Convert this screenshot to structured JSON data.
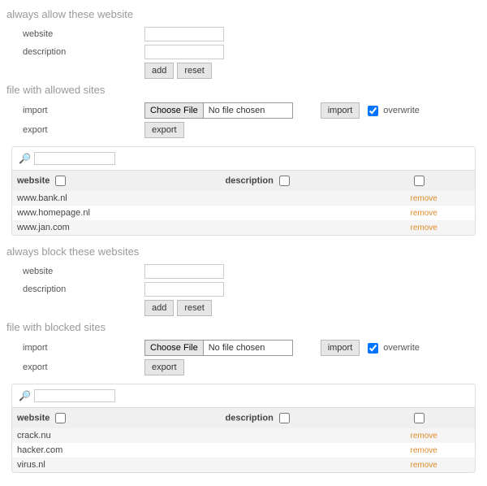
{
  "allow": {
    "title": "always allow these website",
    "website_label": "website",
    "description_label": "description",
    "add": "add",
    "reset": "reset"
  },
  "allow_file": {
    "title": "file with allowed sites",
    "import_label": "import",
    "export_label": "export",
    "choose_file": "Choose File",
    "no_file": "No file chosen",
    "import_btn": "import",
    "overwrite_label": "overwrite",
    "export_btn": "export"
  },
  "allow_table": {
    "header_website": "website",
    "header_description": "description",
    "remove": "remove",
    "rows": [
      {
        "website": "www.bank.nl",
        "description": ""
      },
      {
        "website": "www.homepage.nl",
        "description": ""
      },
      {
        "website": "www.jan.com",
        "description": ""
      }
    ]
  },
  "block": {
    "title": "always block these websites",
    "website_label": "website",
    "description_label": "description",
    "add": "add",
    "reset": "reset"
  },
  "block_file": {
    "title": "file with blocked sites",
    "import_label": "import",
    "export_label": "export",
    "choose_file": "Choose File",
    "no_file": "No file chosen",
    "import_btn": "import",
    "overwrite_label": "overwrite",
    "export_btn": "export"
  },
  "block_table": {
    "header_website": "website",
    "header_description": "description",
    "remove": "remove",
    "rows": [
      {
        "website": "crack.nu",
        "description": ""
      },
      {
        "website": "hacker.com",
        "description": ""
      },
      {
        "website": "virus.nl",
        "description": ""
      }
    ]
  }
}
